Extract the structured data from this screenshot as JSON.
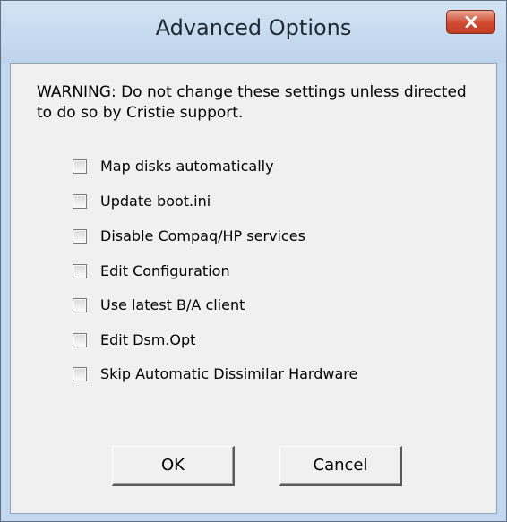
{
  "window": {
    "title": "Advanced Options",
    "close_icon": "close-icon"
  },
  "warning_text": "WARNING: Do not change these settings unless directed to do so by Cristie support.",
  "options": [
    {
      "label": "Map disks automatically",
      "checked": false
    },
    {
      "label": "Update boot.ini",
      "checked": false
    },
    {
      "label": "Disable Compaq/HP services",
      "checked": false
    },
    {
      "label": "Edit Configuration",
      "checked": false
    },
    {
      "label": "Use latest B/A client",
      "checked": false
    },
    {
      "label": "Edit Dsm.Opt",
      "checked": false
    },
    {
      "label": "Skip Automatic Dissimilar Hardware",
      "checked": false
    }
  ],
  "buttons": {
    "ok": "OK",
    "cancel": "Cancel"
  },
  "colors": {
    "frame": "#c2d8ee",
    "client_bg": "#f0f0f0",
    "close_button": "#c9432a"
  }
}
